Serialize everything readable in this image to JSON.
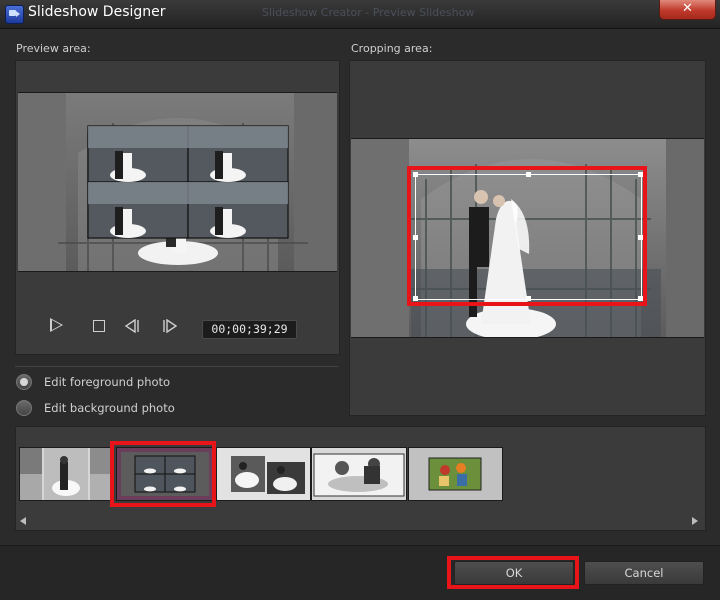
{
  "window": {
    "title": "Slideshow Designer",
    "background_title": "Slideshow Creator - Preview Slideshow",
    "close_label": "✕"
  },
  "preview": {
    "label": "Preview area:",
    "timecode": "00;00;39;29",
    "icons": [
      "play-icon",
      "stop-icon",
      "previous-frame-icon",
      "next-frame-icon"
    ]
  },
  "options": {
    "foreground_label": "Edit foreground photo",
    "background_label": "Edit background photo",
    "selected": "foreground"
  },
  "crop": {
    "label": "Cropping area:"
  },
  "timeline": {
    "thumbnail_count": 5,
    "selected_index": 1
  },
  "buttons": {
    "ok_label": "OK",
    "cancel_label": "Cancel"
  },
  "colors": {
    "highlight": "#e8141a",
    "panel": "#3b3b3b",
    "window": "#2b2b2b"
  }
}
